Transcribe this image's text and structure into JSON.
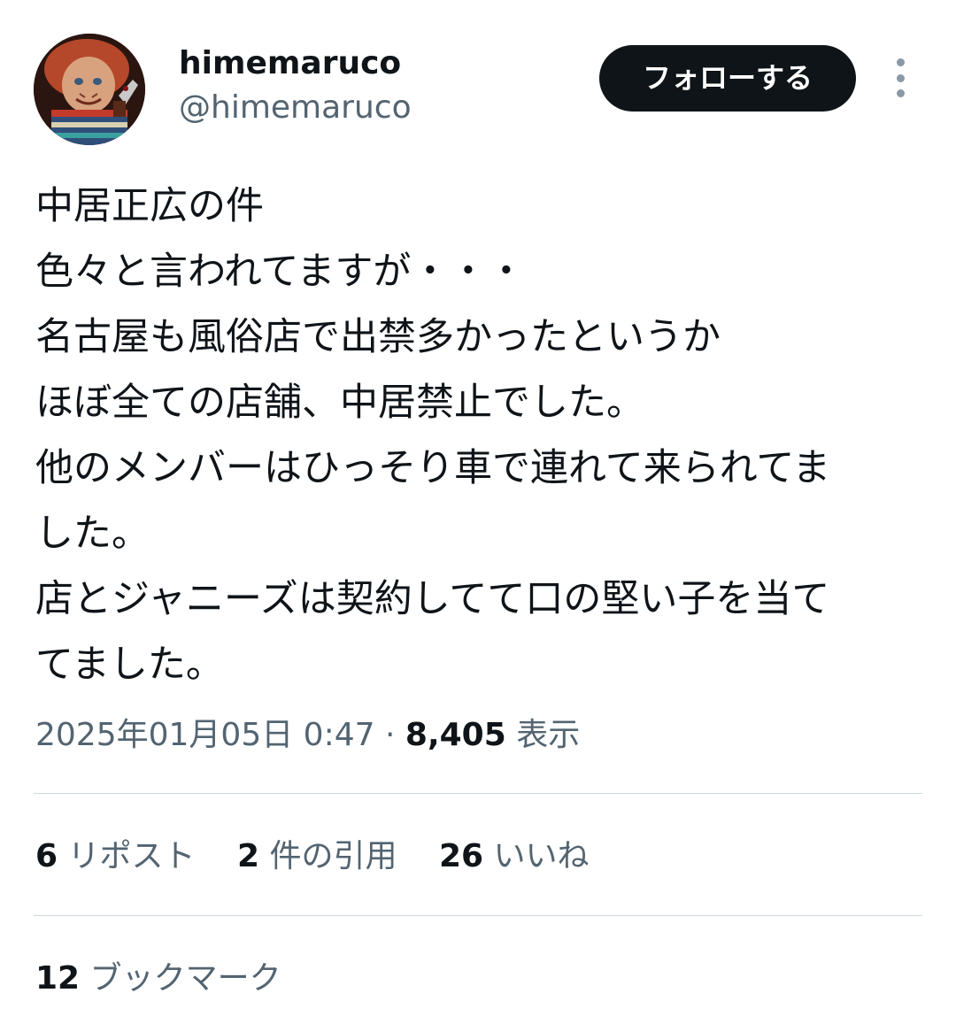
{
  "user": {
    "display_name": "himemaruco",
    "handle": "@himemaruco"
  },
  "follow_button": "フォローする",
  "tweet": {
    "lines": [
      "中居正広の件",
      "色々と言われてますが・・・",
      "名古屋も風俗店で出禁多かったというか",
      "ほぼ全ての店舗、中居禁止でした。",
      "他のメンバーはひっそり車で連れて来られてま",
      "した。",
      "店とジャニーズは契約してて口の堅い子を当て",
      "てました。"
    ]
  },
  "meta": {
    "timestamp": "2025年01月05日 0:47",
    "separator": "·",
    "views_count": "8,405",
    "views_label": "表示"
  },
  "stats": {
    "reposts_count": "6",
    "reposts_label": "リポスト",
    "quotes_count": "2",
    "quotes_label": "件の引用",
    "likes_count": "26",
    "likes_label": "いいね",
    "bookmarks_count": "12",
    "bookmarks_label": "ブックマーク"
  },
  "icons": {
    "more": "more-vertical-icon",
    "avatar": "profile-avatar"
  },
  "colors": {
    "text": "#0f1419",
    "secondary": "#536471",
    "divider": "#cfd9de",
    "button_bg": "#0f1419",
    "button_text": "#ffffff"
  }
}
